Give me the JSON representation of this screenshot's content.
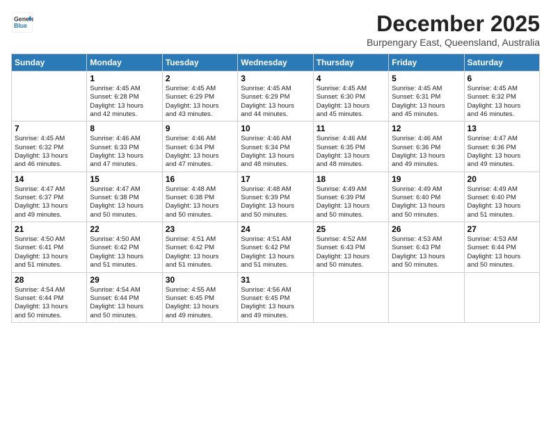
{
  "logo": {
    "line1": "General",
    "line2": "Blue"
  },
  "title": "December 2025",
  "location": "Burpengary East, Queensland, Australia",
  "days": [
    "Sunday",
    "Monday",
    "Tuesday",
    "Wednesday",
    "Thursday",
    "Friday",
    "Saturday"
  ],
  "weeks": [
    [
      {
        "day": "",
        "info": ""
      },
      {
        "day": "1",
        "info": "Sunrise: 4:45 AM\nSunset: 6:28 PM\nDaylight: 13 hours\nand 42 minutes."
      },
      {
        "day": "2",
        "info": "Sunrise: 4:45 AM\nSunset: 6:29 PM\nDaylight: 13 hours\nand 43 minutes."
      },
      {
        "day": "3",
        "info": "Sunrise: 4:45 AM\nSunset: 6:29 PM\nDaylight: 13 hours\nand 44 minutes."
      },
      {
        "day": "4",
        "info": "Sunrise: 4:45 AM\nSunset: 6:30 PM\nDaylight: 13 hours\nand 45 minutes."
      },
      {
        "day": "5",
        "info": "Sunrise: 4:45 AM\nSunset: 6:31 PM\nDaylight: 13 hours\nand 45 minutes."
      },
      {
        "day": "6",
        "info": "Sunrise: 4:45 AM\nSunset: 6:32 PM\nDaylight: 13 hours\nand 46 minutes."
      }
    ],
    [
      {
        "day": "7",
        "info": "Sunrise: 4:45 AM\nSunset: 6:32 PM\nDaylight: 13 hours\nand 46 minutes."
      },
      {
        "day": "8",
        "info": "Sunrise: 4:46 AM\nSunset: 6:33 PM\nDaylight: 13 hours\nand 47 minutes."
      },
      {
        "day": "9",
        "info": "Sunrise: 4:46 AM\nSunset: 6:34 PM\nDaylight: 13 hours\nand 47 minutes."
      },
      {
        "day": "10",
        "info": "Sunrise: 4:46 AM\nSunset: 6:34 PM\nDaylight: 13 hours\nand 48 minutes."
      },
      {
        "day": "11",
        "info": "Sunrise: 4:46 AM\nSunset: 6:35 PM\nDaylight: 13 hours\nand 48 minutes."
      },
      {
        "day": "12",
        "info": "Sunrise: 4:46 AM\nSunset: 6:36 PM\nDaylight: 13 hours\nand 49 minutes."
      },
      {
        "day": "13",
        "info": "Sunrise: 4:47 AM\nSunset: 6:36 PM\nDaylight: 13 hours\nand 49 minutes."
      }
    ],
    [
      {
        "day": "14",
        "info": "Sunrise: 4:47 AM\nSunset: 6:37 PM\nDaylight: 13 hours\nand 49 minutes."
      },
      {
        "day": "15",
        "info": "Sunrise: 4:47 AM\nSunset: 6:38 PM\nDaylight: 13 hours\nand 50 minutes."
      },
      {
        "day": "16",
        "info": "Sunrise: 4:48 AM\nSunset: 6:38 PM\nDaylight: 13 hours\nand 50 minutes."
      },
      {
        "day": "17",
        "info": "Sunrise: 4:48 AM\nSunset: 6:39 PM\nDaylight: 13 hours\nand 50 minutes."
      },
      {
        "day": "18",
        "info": "Sunrise: 4:49 AM\nSunset: 6:39 PM\nDaylight: 13 hours\nand 50 minutes."
      },
      {
        "day": "19",
        "info": "Sunrise: 4:49 AM\nSunset: 6:40 PM\nDaylight: 13 hours\nand 50 minutes."
      },
      {
        "day": "20",
        "info": "Sunrise: 4:49 AM\nSunset: 6:40 PM\nDaylight: 13 hours\nand 51 minutes."
      }
    ],
    [
      {
        "day": "21",
        "info": "Sunrise: 4:50 AM\nSunset: 6:41 PM\nDaylight: 13 hours\nand 51 minutes."
      },
      {
        "day": "22",
        "info": "Sunrise: 4:50 AM\nSunset: 6:42 PM\nDaylight: 13 hours\nand 51 minutes."
      },
      {
        "day": "23",
        "info": "Sunrise: 4:51 AM\nSunset: 6:42 PM\nDaylight: 13 hours\nand 51 minutes."
      },
      {
        "day": "24",
        "info": "Sunrise: 4:51 AM\nSunset: 6:42 PM\nDaylight: 13 hours\nand 51 minutes."
      },
      {
        "day": "25",
        "info": "Sunrise: 4:52 AM\nSunset: 6:43 PM\nDaylight: 13 hours\nand 50 minutes."
      },
      {
        "day": "26",
        "info": "Sunrise: 4:53 AM\nSunset: 6:43 PM\nDaylight: 13 hours\nand 50 minutes."
      },
      {
        "day": "27",
        "info": "Sunrise: 4:53 AM\nSunset: 6:44 PM\nDaylight: 13 hours\nand 50 minutes."
      }
    ],
    [
      {
        "day": "28",
        "info": "Sunrise: 4:54 AM\nSunset: 6:44 PM\nDaylight: 13 hours\nand 50 minutes."
      },
      {
        "day": "29",
        "info": "Sunrise: 4:54 AM\nSunset: 6:44 PM\nDaylight: 13 hours\nand 50 minutes."
      },
      {
        "day": "30",
        "info": "Sunrise: 4:55 AM\nSunset: 6:45 PM\nDaylight: 13 hours\nand 49 minutes."
      },
      {
        "day": "31",
        "info": "Sunrise: 4:56 AM\nSunset: 6:45 PM\nDaylight: 13 hours\nand 49 minutes."
      },
      {
        "day": "",
        "info": ""
      },
      {
        "day": "",
        "info": ""
      },
      {
        "day": "",
        "info": ""
      }
    ]
  ]
}
